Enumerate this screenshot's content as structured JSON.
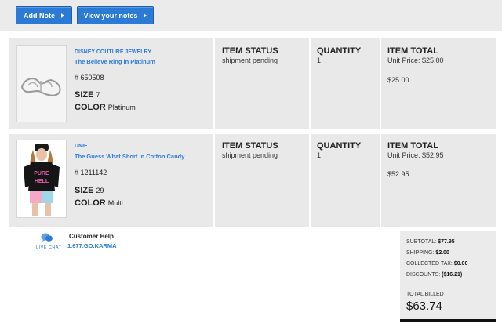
{
  "actions": {
    "add_note": "Add Note",
    "view_notes": "View your notes"
  },
  "columns": {
    "status": "ITEM STATUS",
    "quantity": "QUANTITY",
    "total": "ITEM TOTAL"
  },
  "items": [
    {
      "brand": "DISNEY COUTURE JEWELRY",
      "name": "The Believe Ring in Platinum",
      "sku": "# 650508",
      "size_label": "SIZE",
      "size": "7",
      "color_label": "COLOR",
      "color": "Platinum",
      "status": "shipment pending",
      "quantity": "1",
      "unit_price": "Unit Price: $25.00",
      "total": "$25.00"
    },
    {
      "brand": "UNIF",
      "name": "The Guess What Short in Cotton Candy",
      "sku": "# 1211142",
      "size_label": "SIZE",
      "size": "29",
      "color_label": "COLOR",
      "color": "Multi",
      "status": "shipment pending",
      "quantity": "1",
      "unit_price": "Unit Price: $52.95",
      "total": "$52.95"
    }
  ],
  "help": {
    "title": "Customer Help",
    "phone": "1.677.GO.KARMA",
    "live_chat": "LIVE CHAT"
  },
  "summary": {
    "subtotal_label": "SUBTOTAL:",
    "subtotal": "$77.95",
    "shipping_label": "SHIPPING:",
    "shipping": "$2.00",
    "tax_label": "COLLECTED TAX:",
    "tax": "$0.00",
    "discounts_label": "DISCOUNTS:",
    "discounts": "($16.21)",
    "total_billed_label": "TOTAL BILLED",
    "total_billed": "$63.74"
  },
  "colors": {
    "accent": "#2b7bd6",
    "row_bg": "#e9e9e9"
  }
}
